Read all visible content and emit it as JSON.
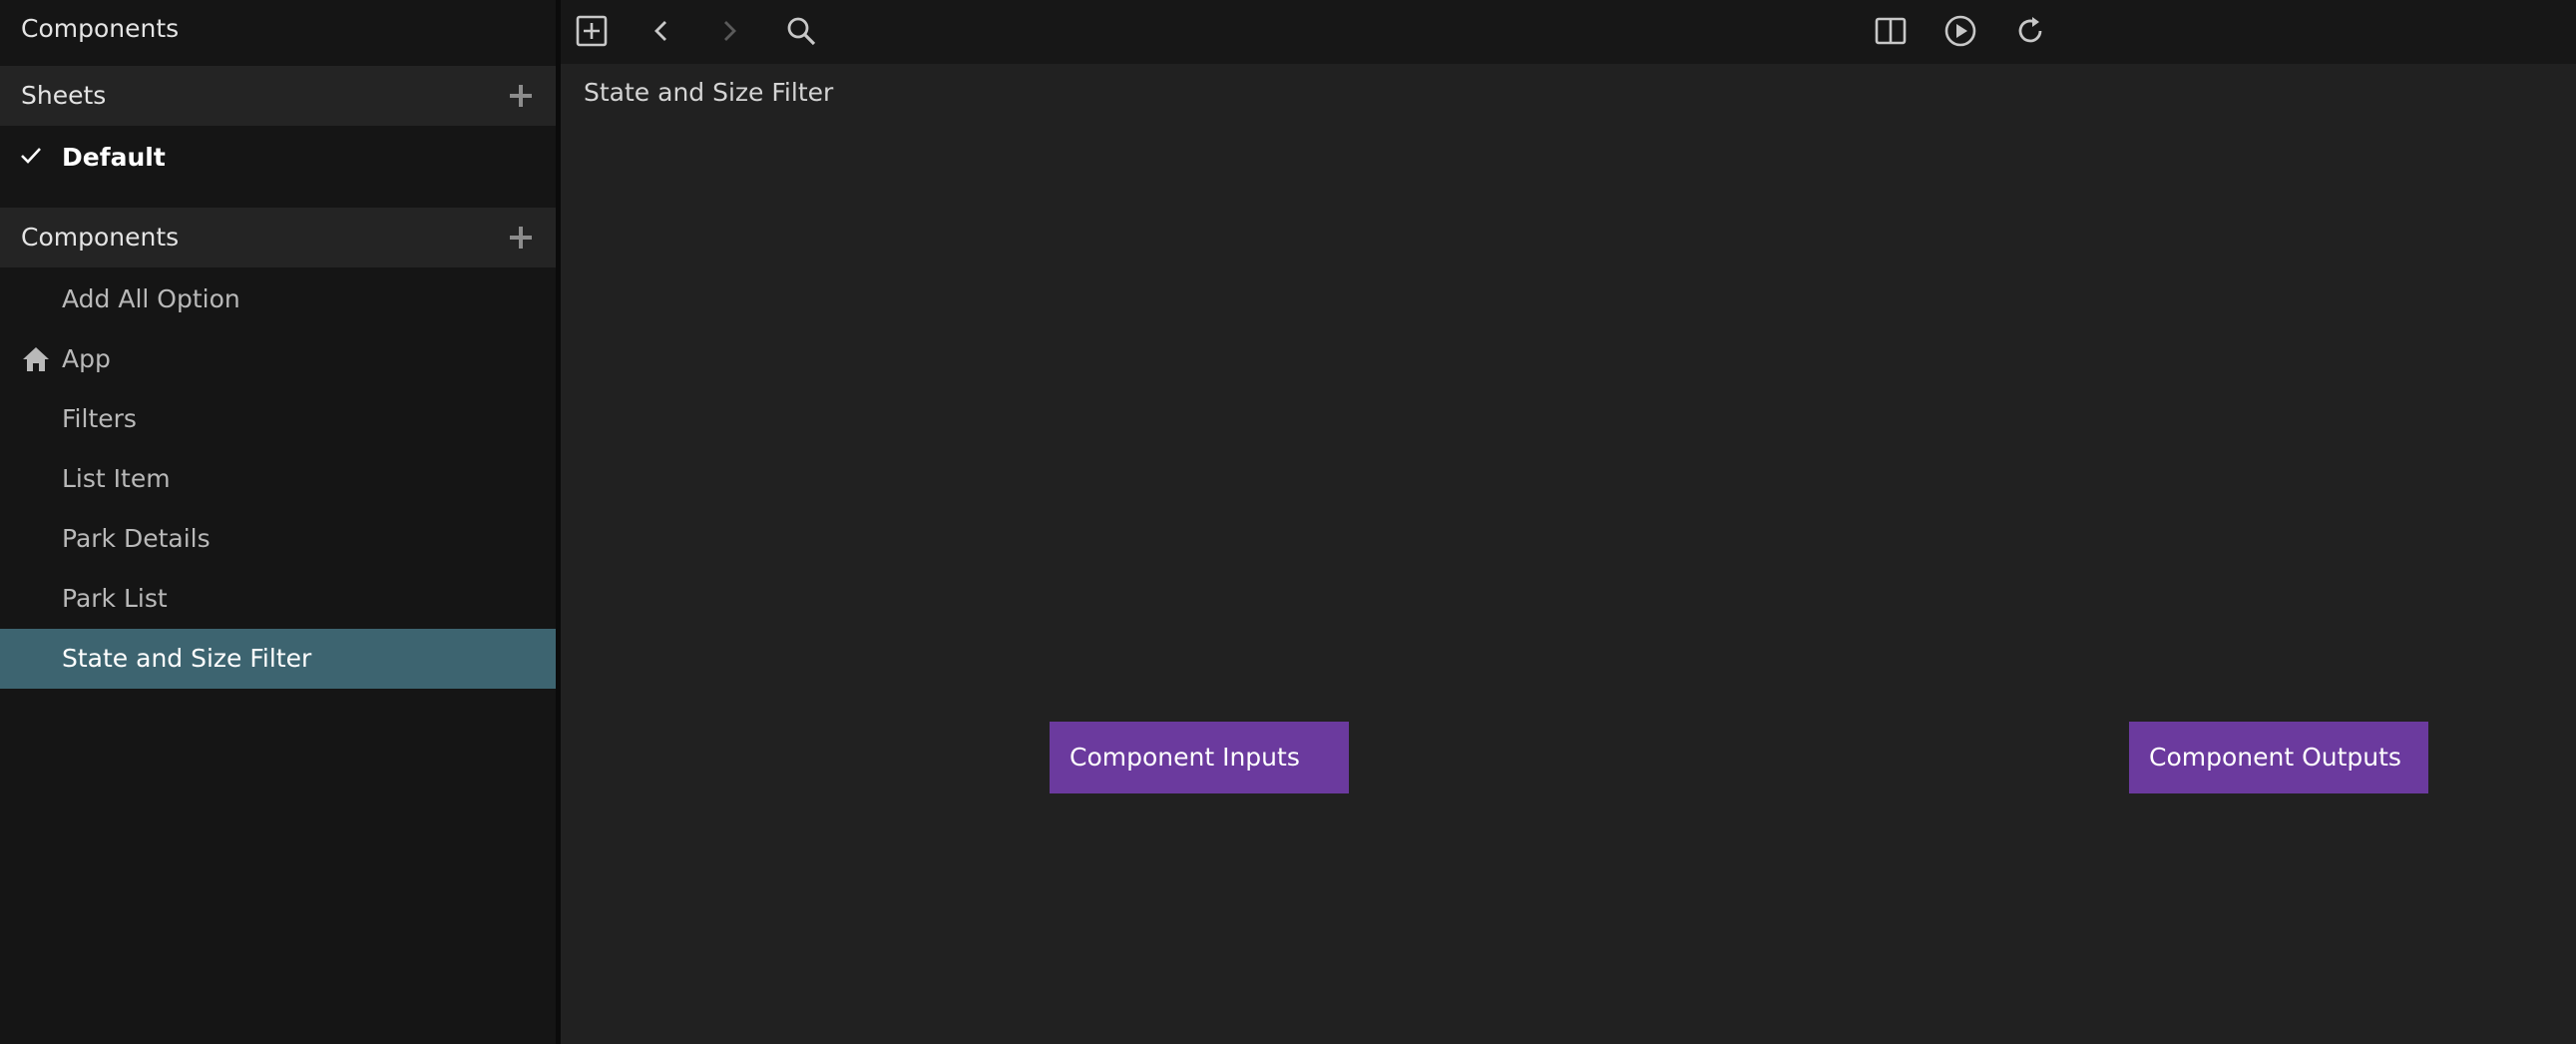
{
  "sidebar": {
    "title": "Components",
    "sheets": {
      "header": "Sheets",
      "items": [
        {
          "label": "Default",
          "checked": true
        }
      ]
    },
    "components": {
      "header": "Components",
      "items": [
        {
          "label": "Add All Option",
          "icon": ""
        },
        {
          "label": "App",
          "icon": "home-icon"
        },
        {
          "label": "Filters",
          "icon": ""
        },
        {
          "label": "List Item",
          "icon": ""
        },
        {
          "label": "Park Details",
          "icon": ""
        },
        {
          "label": "Park List",
          "icon": ""
        },
        {
          "label": "State and Size Filter",
          "icon": "",
          "selected": true
        }
      ]
    }
  },
  "toolbar": {
    "icons": [
      "add-node-icon",
      "back-icon",
      "forward-icon",
      "search-icon",
      "split-view-icon",
      "play-icon",
      "refresh-icon"
    ]
  },
  "canvas": {
    "title": "State and Size Filter",
    "nodes": {
      "inputs": "Component Inputs",
      "outputs": "Component Outputs"
    }
  },
  "colors": {
    "accent_selected": "#3d6470",
    "node_purple": "#6b3a9e",
    "background": "#212121",
    "sidebar_bg": "#151515"
  }
}
